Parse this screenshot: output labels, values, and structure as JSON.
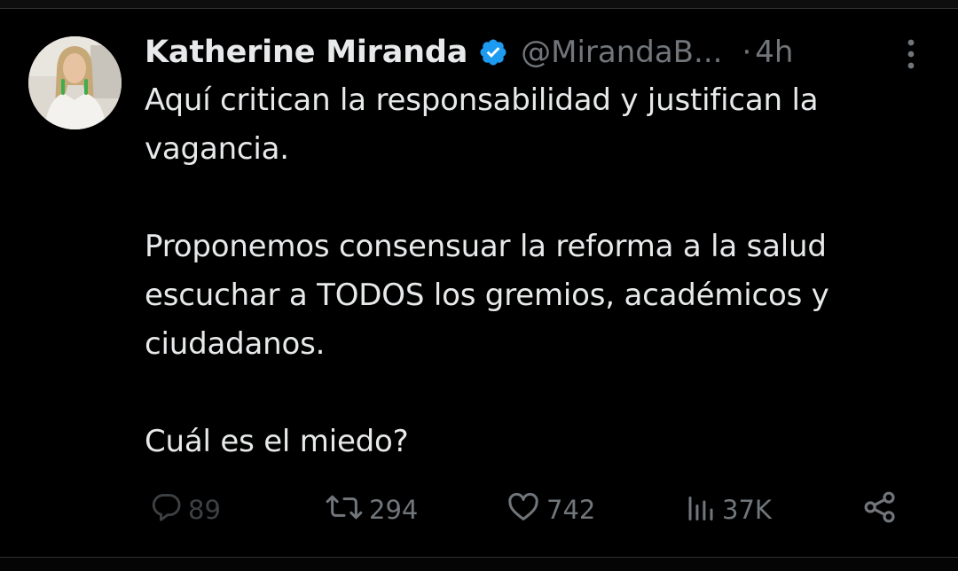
{
  "tweet": {
    "author_name": "Katherine Miranda",
    "handle": "@MirandaB...",
    "separator": "·",
    "time": "4h",
    "paragraphs": [
      "Aquí critican la responsabilidad y justifican la vagancia.",
      "Proponemos consensuar la reforma a la salud escuchar a TODOS los gremios, académicos y ciudadanos.",
      "Cuál es el miedo?"
    ],
    "verified": true,
    "actions": {
      "replies": "89",
      "retweets": "294",
      "likes": "742",
      "views": "37K"
    }
  },
  "icons": {
    "verified": "verified-badge-icon",
    "more": "more-vertical-icon",
    "reply": "reply-icon",
    "retweet": "retweet-icon",
    "like": "heart-icon",
    "views": "views-bar-chart-icon",
    "share": "share-icon"
  },
  "colors": {
    "background": "#000000",
    "text_primary": "#e7e9ea",
    "text_secondary": "#71767b",
    "verified_blue": "#1d9bf0",
    "divider": "#2f3336"
  }
}
